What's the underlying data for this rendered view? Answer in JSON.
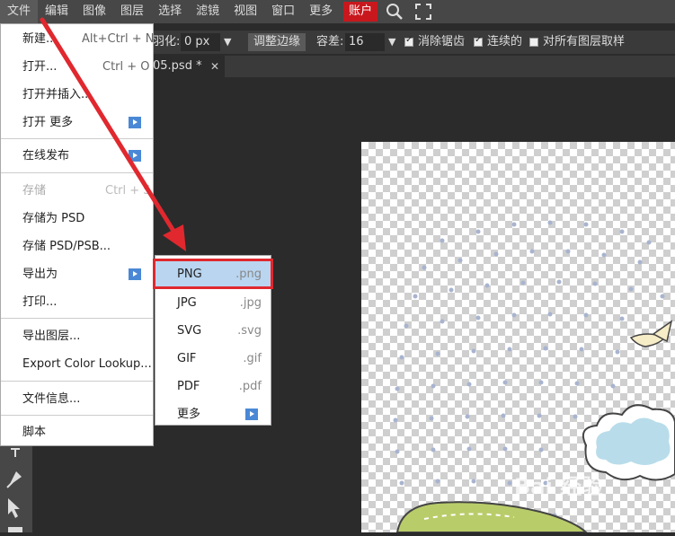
{
  "menubar": {
    "items": [
      "文件",
      "编辑",
      "图像",
      "图层",
      "选择",
      "滤镜",
      "视图",
      "窗口",
      "更多"
    ],
    "account": "账户"
  },
  "options": {
    "feather_label": "羽化:",
    "feather_value": "0 px",
    "refine_edge": "调整边缘",
    "tolerance_label": "容差:",
    "tolerance_value": "16",
    "antialias": "消除锯齿",
    "contiguous": "连续的",
    "all_layers": "对所有图层取样"
  },
  "tab": {
    "title": "05.psd *",
    "close": "✕"
  },
  "file_menu": {
    "items": [
      {
        "label": "新建...",
        "shortcut": "Alt+Ctrl + N"
      },
      {
        "label": "打开...",
        "shortcut": "Ctrl + O"
      },
      {
        "label": "打开并插入..."
      },
      {
        "label": "打开 更多"
      },
      {
        "label": "在线发布"
      },
      {
        "label": "存储",
        "shortcut": "Ctrl + S"
      },
      {
        "label": "存储为 PSD"
      },
      {
        "label": "存储 PSD/PSB..."
      },
      {
        "label": "导出为"
      },
      {
        "label": "打印..."
      },
      {
        "label": "导出图层..."
      },
      {
        "label": "Export Color Lookup..."
      },
      {
        "label": "文件信息..."
      },
      {
        "label": "脚本"
      }
    ]
  },
  "export_menu": {
    "items": [
      {
        "label": "PNG",
        "ext": ".png"
      },
      {
        "label": "JPG",
        "ext": ".jpg"
      },
      {
        "label": "SVG",
        "ext": ".svg"
      },
      {
        "label": "GIF",
        "ext": ".gif"
      },
      {
        "label": "PDF",
        "ext": ".pdf"
      },
      {
        "label": "更多"
      }
    ]
  },
  "colors": {
    "highlight_box": "#e0282e",
    "annotation_arrow": "#e0282e",
    "account_bg": "#c8181e"
  },
  "watermark": "Bai 经验"
}
